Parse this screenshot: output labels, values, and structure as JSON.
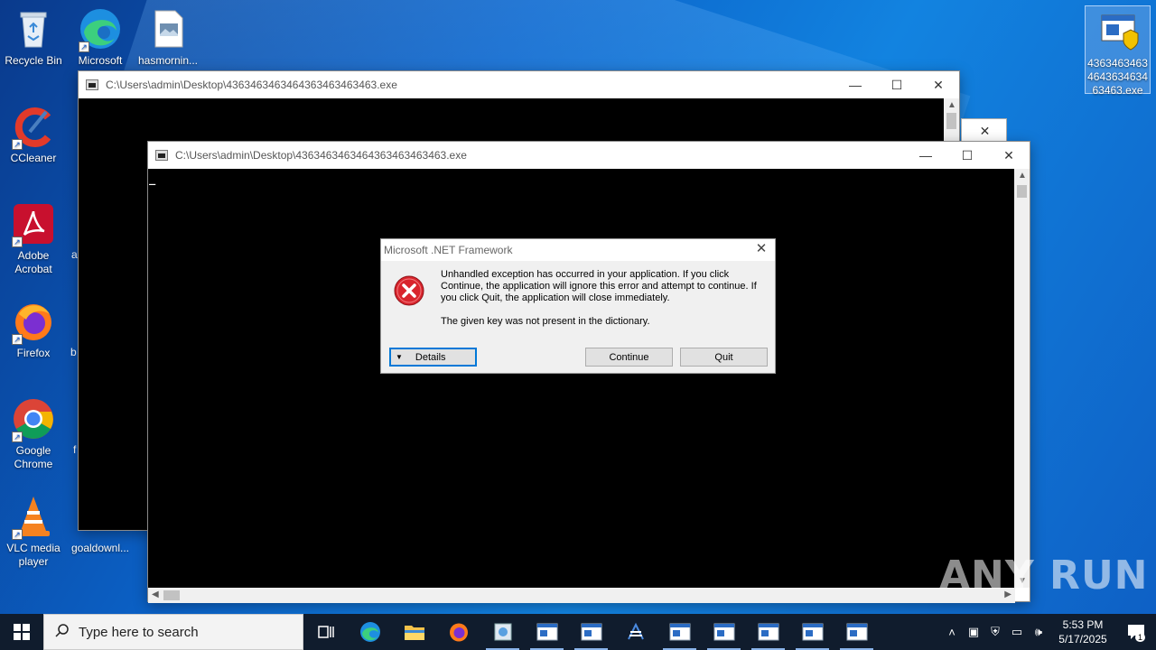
{
  "desktop": {
    "icons": [
      {
        "label": "Recycle Bin",
        "icon": "recycle-bin-icon"
      },
      {
        "label": "Microsoft Edge",
        "icon": "edge-icon"
      },
      {
        "label": "hasmornin...",
        "icon": "file-icon"
      },
      {
        "label": "CCleaner",
        "icon": "ccleaner-icon"
      },
      {
        "label": "Adobe Acrobat",
        "icon": "acrobat-icon"
      },
      {
        "label": "Firefox",
        "icon": "firefox-icon"
      },
      {
        "label": "Google Chrome",
        "icon": "chrome-icon"
      },
      {
        "label": "VLC media player",
        "icon": "vlc-icon"
      },
      {
        "label": "goaldownl...",
        "icon": "file-icon"
      },
      {
        "label": "4363463463464363463463463.exe",
        "icon": "exe-icon"
      }
    ],
    "partial_labels": [
      "a",
      "b",
      "f"
    ]
  },
  "window_back": {
    "title": "C:\\Users\\admin\\Desktop\\4363463463464363463463463.exe"
  },
  "window_front": {
    "title": "C:\\Users\\admin\\Desktop\\4363463463464363463463463.exe",
    "cursor": "_"
  },
  "dialog": {
    "title": "Microsoft .NET Framework",
    "message": "Unhandled exception has occurred in your application. If you click Continue, the application will ignore this error and attempt to continue. If you click Quit, the application will close immediately.",
    "detail": "The given key was not present in the dictionary.",
    "details_button": "Details",
    "continue_button": "Continue",
    "quit_button": "Quit"
  },
  "taskbar": {
    "search_placeholder": "Type here to search",
    "time": "5:53 PM",
    "date": "5/17/2025",
    "notification_count": "1"
  },
  "watermark": "ANY RUN",
  "colors": {
    "desktop_blue": "#0b63c9",
    "taskbar": "#101c2d",
    "error_red": "#d9252d",
    "focus_blue": "#0078d7"
  }
}
